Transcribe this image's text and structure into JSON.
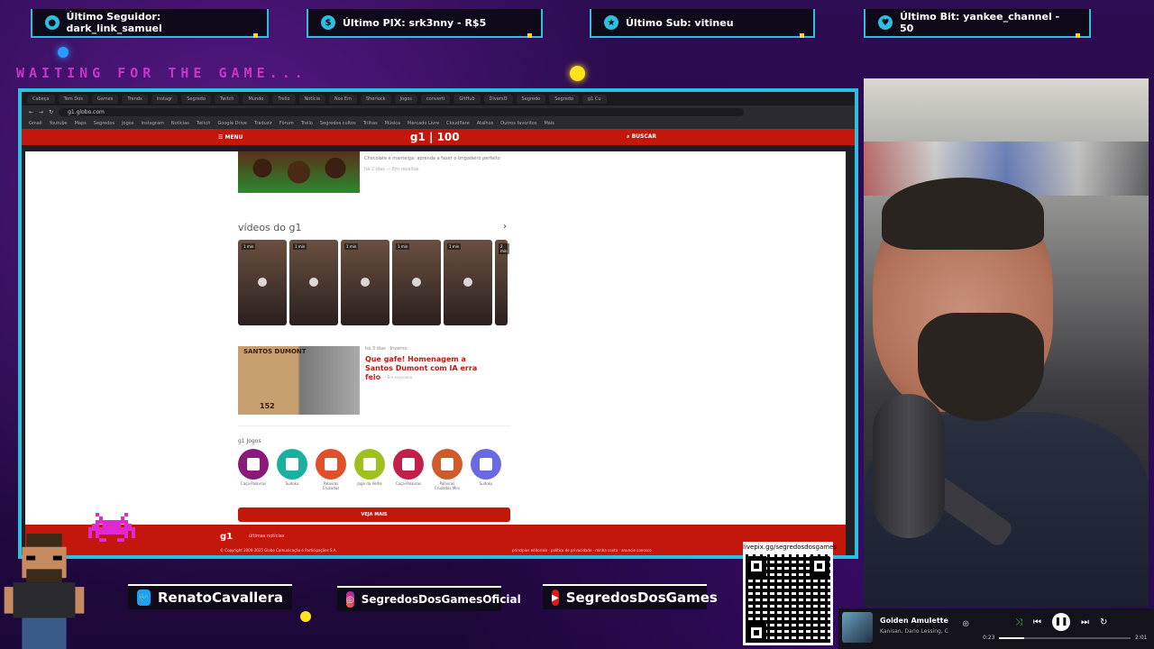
{
  "alerts": {
    "follower": "Último Seguidor: dark_link_samuel",
    "pix": "Último PIX: srk3nny - R$5",
    "sub": "Último Sub: vitineu",
    "bit": "Último Bit: yankee_channel - 50"
  },
  "waiting_text": "WAITING FOR THE GAME...",
  "browser": {
    "tabs": [
      "Cabeça",
      "Tem Dos",
      "Games",
      "Trends",
      "Instagr",
      "Segredo",
      "Twitch",
      "Mundo",
      "Trello",
      "Notícia",
      "Nos Em",
      "Sherlock",
      "Jogos",
      "converti",
      "GitHub",
      "DiversO",
      "Segredo",
      "Segredo",
      "g1 Cu"
    ],
    "url": "g1.globo.com",
    "bookmarks": [
      "Gmail",
      "Youtube",
      "Maps",
      "Segredos",
      "Jogos",
      "Instagram",
      "Notícias",
      "Twitch",
      "Google Drive",
      "Traduzir",
      "Fórum",
      "Trello",
      "Segredos cultos",
      "Trilhas",
      "Música",
      "Mercado Livre",
      "Cloudflare",
      "Atalhos",
      "Outros favoritos",
      "Mais"
    ],
    "menu_label": "MENU",
    "logo": "g1 | 100",
    "search_label": "BUSCAR"
  },
  "g1": {
    "brigadeiro_text": "Chocolate e manteiga: aprenda a fazer o brigadeiro perfeito",
    "brigadeiro_meta": "há 2 dias — Em receitas",
    "videos_title": "vídeos do g1",
    "video_durations": [
      "1 min",
      "1 min",
      "1 min",
      "1 min",
      "1 min",
      "2 min"
    ],
    "news": {
      "meta": "há 3 dias · Inverno",
      "title": "Que gafe! Homenagem a Santos Dumont com IA erra feio",
      "sub": "há 3 dias — Em economia",
      "image_caption": "SANTOS DUMONT",
      "image_number": "152"
    },
    "games_title": "g1 Jogos",
    "games": [
      {
        "label": "Caça-Palavras",
        "color": "#8a1a7a"
      },
      {
        "label": "Sudoku",
        "color": "#1ab0a0"
      },
      {
        "label": "Palavras Cruzadas",
        "color": "#e0502a"
      },
      {
        "label": "Jogo da Velha",
        "color": "#a0c020"
      },
      {
        "label": "Caça-Palavras",
        "color": "#c0204a"
      },
      {
        "label": "Palavras Cruzadas Mini",
        "color": "#d05a2a"
      },
      {
        "label": "Sudoku",
        "color": "#6a6ae0"
      }
    ],
    "see_more": "VEJA MAIS",
    "footer_logo": "g1",
    "footer_slogan": "últimas notícias",
    "footer_copy": "© Copyright 2000-2025 Globo Comunicação e Participações S.A.",
    "footer_links": "princípios editoriais · política de privacidade · minha conta · anuncie conosco"
  },
  "social": {
    "twitter": "RenatoCavallera",
    "instagram": "SegredosDosGamesOficial",
    "youtube": "SegredosDosGames"
  },
  "qr": {
    "label": "livepix.gg/segredosdosgames"
  },
  "player": {
    "song": "Golden Amulette",
    "artist": "Kanisan, Dario Lessing, C",
    "elapsed": "0:23",
    "total": "2:01",
    "progress": 0.19
  },
  "colors": {
    "accent": "#2bc0e0",
    "g1_red": "#c4170c",
    "background": "#2a0a4a"
  }
}
